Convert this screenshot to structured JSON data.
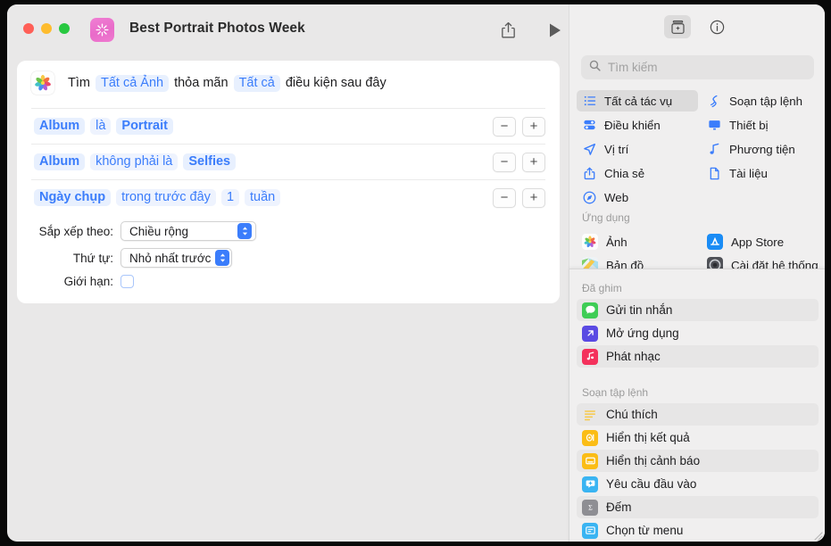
{
  "window": {
    "title": "Best Portrait Photos Week",
    "app_icon": "shortcuts-icon",
    "traffic_lights": [
      "close",
      "minimize",
      "zoom"
    ],
    "toolbar": {
      "share_label": "share-icon",
      "run_label": "run-icon"
    }
  },
  "find_row": {
    "icon": "photos-app-icon",
    "word_find": "Tìm",
    "token_source": "Tất cả Ảnh",
    "word_match": "thỏa mãn",
    "token_quantifier": "Tất cả",
    "word_suffix": "điều kiện sau đây"
  },
  "conditions": [
    {
      "field": "Album",
      "operator": "là",
      "value": "Portrait",
      "extra": null,
      "unit": null,
      "remove_label": "−",
      "add_label": "+"
    },
    {
      "field": "Album",
      "operator": "không phải là",
      "value": "Selfies",
      "extra": null,
      "unit": null,
      "remove_label": "−",
      "add_label": "+"
    },
    {
      "field": "Ngày chụp",
      "operator": "trong trước đây",
      "value": "1",
      "extra": null,
      "unit": "tuần",
      "remove_label": "−",
      "add_label": "+"
    }
  ],
  "form": {
    "sort_label": "Sắp xếp theo:",
    "sort_value": "Chiều rộng",
    "order_label": "Thứ tự:",
    "order_value": "Nhỏ nhất trước",
    "limit_label": "Giới hạn:",
    "limit_checked": false
  },
  "sidebar": {
    "tabs": [
      {
        "name": "action-library",
        "icon": "action-library-icon",
        "active": true
      },
      {
        "name": "info",
        "icon": "info-circle-icon",
        "active": false
      }
    ],
    "search": {
      "placeholder": "Tìm kiếm",
      "value": "",
      "icon": "search-icon"
    },
    "categories_left": [
      {
        "label": "Tất cả tác vụ",
        "icon": "list-bullet-icon",
        "color": "#3b7dfb",
        "active": true
      },
      {
        "label": "Điều khiển",
        "icon": "sliders-icon",
        "color": "#3b7dfb",
        "active": false
      },
      {
        "label": "Vị trí",
        "icon": "location-arrow-icon",
        "color": "#3b7dfb",
        "active": false
      },
      {
        "label": "Chia sẻ",
        "icon": "share-icon",
        "color": "#3b7dfb",
        "active": false
      },
      {
        "label": "Web",
        "icon": "compass-icon",
        "color": "#3b7dfb",
        "active": false
      }
    ],
    "categories_right": [
      {
        "label": "Soạn tập lệnh",
        "icon": "scripting-icon",
        "color": "#3b7dfb",
        "active": false
      },
      {
        "label": "Thiết bị",
        "icon": "display-icon",
        "color": "#3b7dfb",
        "active": false
      },
      {
        "label": "Phương tiện",
        "icon": "music-note-icon",
        "color": "#3b7dfb",
        "active": false
      },
      {
        "label": "Tài liệu",
        "icon": "document-icon",
        "color": "#3b7dfb",
        "active": false
      }
    ],
    "apps_heading": "Ứng dụng",
    "apps_left": [
      {
        "label": "Ảnh",
        "icon": "photos-app-icon"
      },
      {
        "label": "Bản đồ",
        "icon": "maps-app-icon"
      }
    ],
    "apps_right": [
      {
        "label": "App Store",
        "icon": "app-store-icon"
      },
      {
        "label": "Cài đặt hệ thống",
        "icon": "system-settings-icon"
      }
    ],
    "pinned_heading": "Đã ghim",
    "pinned": [
      {
        "label": "Gửi tin nhắn",
        "icon": "messages-icon",
        "color": "#3fcd56",
        "alt": true
      },
      {
        "label": "Mở ứng dụng",
        "icon": "open-app-icon",
        "color": "#5a4ae3",
        "alt": false
      },
      {
        "label": "Phát nhạc",
        "icon": "music-icon",
        "color": "#f4315c",
        "alt": true
      }
    ],
    "scripting_heading": "Soạn tập lệnh",
    "scripting": [
      {
        "label": "Chú thích",
        "icon": "comment-icon",
        "color": "#f7c948",
        "alt": true
      },
      {
        "label": "Hiển thị kết quả",
        "icon": "show-result-icon",
        "color": "#fbbd16",
        "alt": false
      },
      {
        "label": "Hiển thị cảnh báo",
        "icon": "show-alert-icon",
        "color": "#fbbd16",
        "alt": true
      },
      {
        "label": "Yêu cầu đầu vào",
        "icon": "ask-input-icon",
        "color": "#3ab4f2",
        "alt": false
      },
      {
        "label": "Đếm",
        "icon": "count-icon",
        "color": "#8e8e93",
        "alt": true
      },
      {
        "label": "Chọn từ menu",
        "icon": "choose-menu-icon",
        "color": "#3ab4f2",
        "alt": false
      }
    ]
  },
  "colors": {
    "accent": "#3b7dfb",
    "token_bg": "#e8f0fe",
    "window_bg": "#e9e8e8",
    "sidebar_bg": "#f0efef",
    "card_bg": "#ffffff"
  }
}
